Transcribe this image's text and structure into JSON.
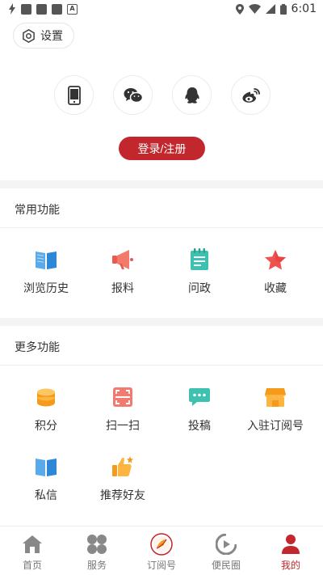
{
  "status_bar": {
    "time": "6:01"
  },
  "settings": {
    "label": "设置"
  },
  "social": [
    "phone-icon",
    "wechat-icon",
    "qq-icon",
    "weibo-icon"
  ],
  "login": {
    "label": "登录/注册"
  },
  "common": {
    "title": "常用功能",
    "items": [
      {
        "label": "浏览历史",
        "icon": "book-icon"
      },
      {
        "label": "报料",
        "icon": "megaphone-icon"
      },
      {
        "label": "问政",
        "icon": "notepad-icon"
      },
      {
        "label": "收藏",
        "icon": "star-icon"
      }
    ]
  },
  "more": {
    "title": "更多功能",
    "items": [
      {
        "label": "积分",
        "icon": "coins-icon"
      },
      {
        "label": "扫一扫",
        "icon": "scan-icon"
      },
      {
        "label": "投稿",
        "icon": "chat-icon"
      },
      {
        "label": "入驻订阅号",
        "icon": "shop-icon"
      },
      {
        "label": "私信",
        "icon": "book-icon"
      },
      {
        "label": "推荐好友",
        "icon": "thumbs-up-icon"
      }
    ]
  },
  "nav": [
    {
      "label": "首页",
      "icon": "home-icon",
      "active": false
    },
    {
      "label": "服务",
      "icon": "grid-icon",
      "active": false
    },
    {
      "label": "订阅号",
      "icon": "subscribe-icon",
      "active": false
    },
    {
      "label": "便民圈",
      "icon": "circle-icon",
      "active": false
    },
    {
      "label": "我的",
      "icon": "user-icon",
      "active": true
    }
  ],
  "colors": {
    "accent": "#c1272d",
    "bg_gap": "#f4f4f4"
  }
}
